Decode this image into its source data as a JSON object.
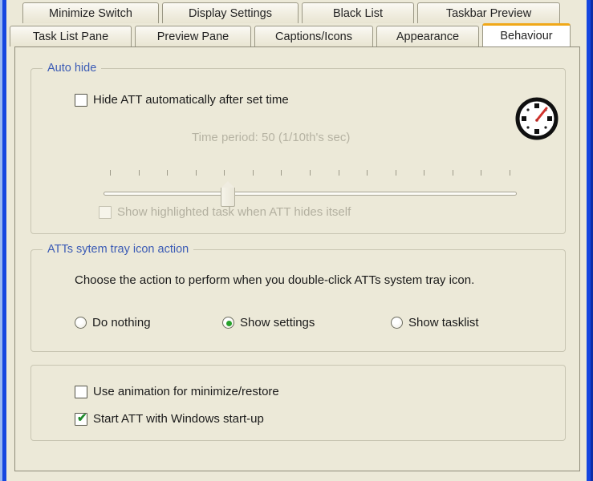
{
  "window": {
    "frame_color": "#1546e0",
    "client_bg": "#ece9d8"
  },
  "tabs": {
    "accent_color": "#f0a818",
    "row_top": [
      {
        "label": "Minimize Switch",
        "selected": false
      },
      {
        "label": "Display Settings",
        "selected": false
      },
      {
        "label": "Black List",
        "selected": false
      },
      {
        "label": "Taskbar Preview",
        "selected": false
      }
    ],
    "row_bottom": [
      {
        "label": "Task List Pane",
        "selected": false
      },
      {
        "label": "Preview Pane",
        "selected": false
      },
      {
        "label": "Captions/Icons",
        "selected": false
      },
      {
        "label": "Appearance",
        "selected": false
      },
      {
        "label": "Behaviour",
        "selected": true
      }
    ]
  },
  "groups": {
    "auto_hide": {
      "title": "Auto hide",
      "title_color": "#3b5bb5",
      "hide_checkbox": {
        "label": "Hide ATT automatically after set time",
        "checked": false,
        "enabled": true
      },
      "time_period_label": "Time period: 50 (1/10th's sec)",
      "time_period_value": 50,
      "time_period_units": "1/10th's sec",
      "slider": {
        "enabled": false,
        "tick_count": 15,
        "thumb_position_percent": 30
      },
      "show_highlighted_checkbox": {
        "label": "Show highlighted task when ATT hides itself",
        "checked": false,
        "enabled": false
      },
      "icon": "stopwatch-icon"
    },
    "tray_action": {
      "title": "ATTs sytem tray icon action",
      "title_color": "#3b5bb5",
      "description": "Choose the action to perform when you double-click ATTs system tray icon.",
      "radio_selected_color": "#27a12c",
      "options": [
        {
          "label": "Do nothing",
          "selected": false
        },
        {
          "label": "Show settings",
          "selected": true
        },
        {
          "label": "Show tasklist",
          "selected": false
        }
      ]
    },
    "misc": {
      "animation_checkbox": {
        "label": "Use animation for minimize/restore",
        "checked": false,
        "enabled": true
      },
      "startup_checkbox": {
        "label": "Start ATT with Windows start-up",
        "checked": true,
        "enabled": true,
        "check_color": "#1f8a2a",
        "check_glyph": "✔"
      }
    }
  }
}
